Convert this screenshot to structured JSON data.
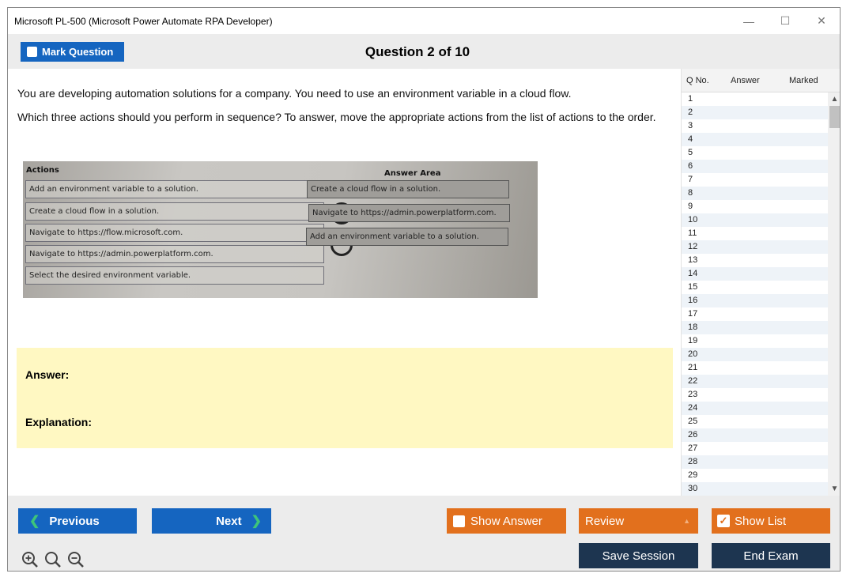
{
  "window": {
    "title": "Microsoft PL-500 (Microsoft Power Automate RPA Developer)",
    "controls": [
      "—",
      "☐",
      "✕"
    ]
  },
  "header": {
    "mark_question_label": "Mark Question",
    "question_title": "Question 2 of 10"
  },
  "question": {
    "text1": "You are developing automation solutions for a company. You need to use an environment variable in a cloud flow.",
    "text2": "Which three actions should you perform in sequence? To answer, move the appropriate actions from the list of actions to the order."
  },
  "exhibit": {
    "actions_label": "Actions",
    "answer_area_label": "Answer Area",
    "actions": [
      "Add an environment variable to a solution.",
      "Create a cloud flow in a solution.",
      "Navigate to https://flow.microsoft.com.",
      "Navigate to https://admin.powerplatform.com.",
      "Select the desired environment variable."
    ],
    "answers": [
      "Create a cloud flow in a solution.",
      "Navigate to https://admin.powerplatform.com.",
      "Add an environment variable to a solution."
    ]
  },
  "answer_panel": {
    "answer_label": "Answer:",
    "explanation_label": "Explanation:"
  },
  "sidelist": {
    "col_qno": "Q No.",
    "col_answer": "Answer",
    "col_marked": "Marked",
    "rows": [
      "1",
      "2",
      "3",
      "4",
      "5",
      "6",
      "7",
      "8",
      "9",
      "10",
      "11",
      "12",
      "13",
      "14",
      "15",
      "16",
      "17",
      "18",
      "19",
      "20",
      "21",
      "22",
      "23",
      "24",
      "25",
      "26",
      "27",
      "28",
      "29",
      "30"
    ]
  },
  "footer": {
    "previous_label": "Previous",
    "next_label": "Next",
    "show_answer_label": "Show Answer",
    "review_label": "Review",
    "show_list_label": "Show List",
    "save_session_label": "Save Session",
    "end_exam_label": "End Exam",
    "show_answer_checked": false,
    "show_list_checked": true
  },
  "colors": {
    "blue": "#1565c0",
    "orange": "#e2701d",
    "navy": "#1d3550",
    "answer_bg": "#fff8c2"
  }
}
